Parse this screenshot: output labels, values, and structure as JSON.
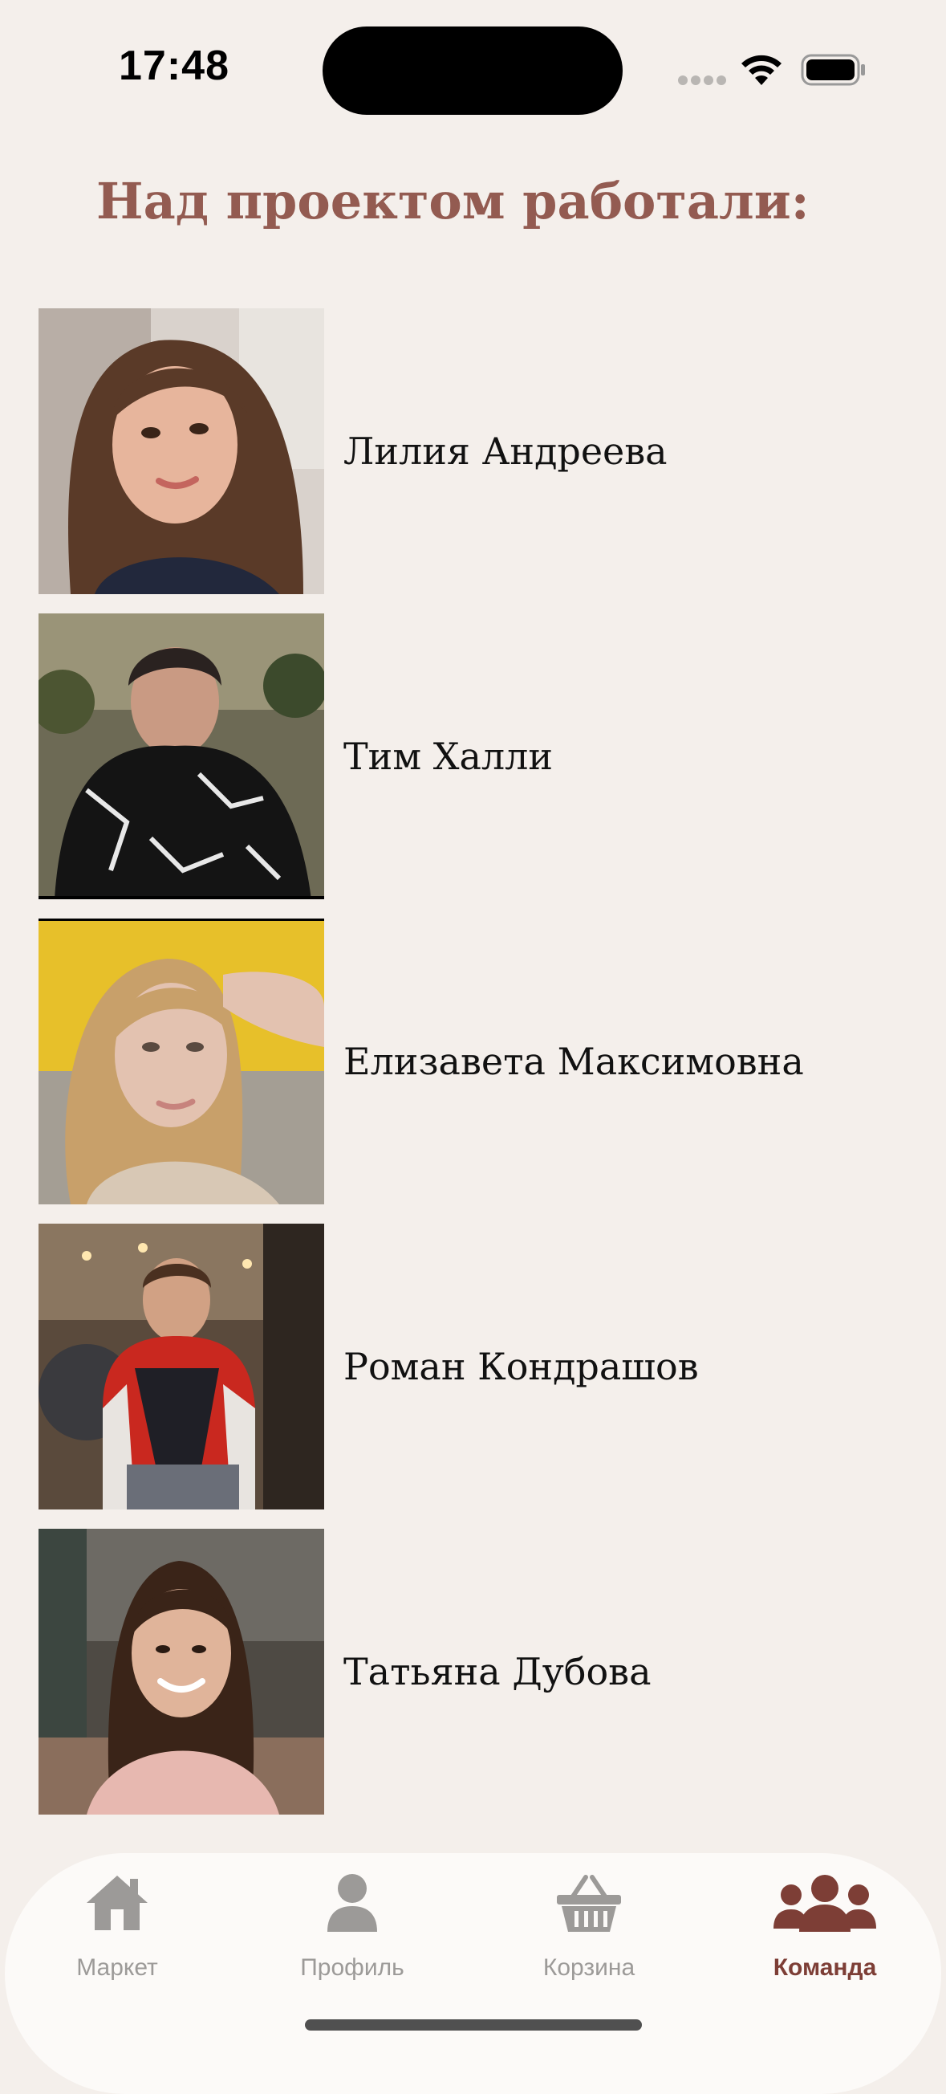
{
  "status_bar": {
    "time": "17:48"
  },
  "header": {
    "title": "Над проектом работали:"
  },
  "team": [
    {
      "name": "Лилия Андреева",
      "photo": "portrait-photo"
    },
    {
      "name": "Тим Халли",
      "photo": "portrait-photo"
    },
    {
      "name": "Елизавета Максимовна",
      "photo": "portrait-photo"
    },
    {
      "name": "Роман Кондрашов",
      "photo": "portrait-photo"
    },
    {
      "name": "Татьяна Дубова",
      "photo": "portrait-photo"
    }
  ],
  "tab_bar": {
    "tabs": [
      {
        "label": "Маркет",
        "icon": "house-icon",
        "active": false
      },
      {
        "label": "Профиль",
        "icon": "person-icon",
        "active": false
      },
      {
        "label": "Корзина",
        "icon": "basket-icon",
        "active": false
      },
      {
        "label": "Команда",
        "icon": "group-icon",
        "active": true
      }
    ]
  },
  "colors": {
    "background": "#f4efeb",
    "accent": "#935b51",
    "active_tab": "#7d3e36",
    "inactive_tab": "#9c9a98"
  }
}
